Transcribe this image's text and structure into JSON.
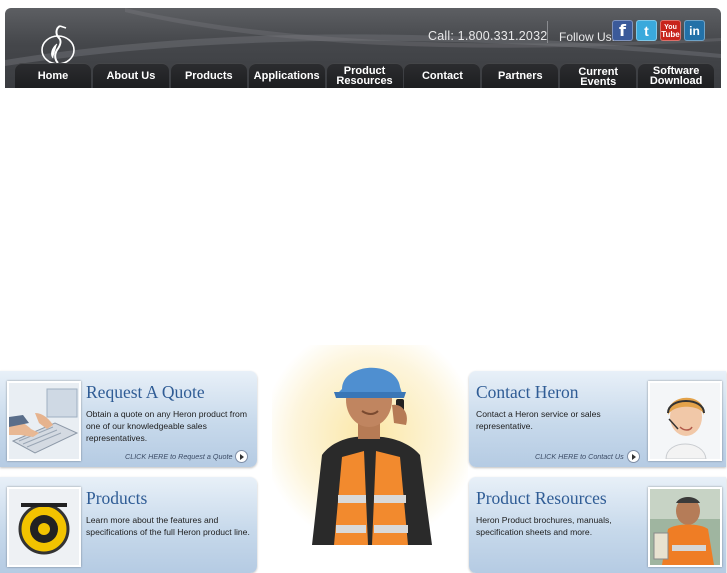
{
  "header": {
    "call_text": "Call: 1.800.331.2032",
    "follow_text": "Follow Us:",
    "social": [
      {
        "name": "facebook-icon",
        "glyph": "f"
      },
      {
        "name": "twitter-icon",
        "glyph": "t"
      },
      {
        "name": "youtube-icon",
        "glyph_top": "You",
        "glyph_bottom": "Tube"
      },
      {
        "name": "linkedin-icon",
        "glyph": "in"
      }
    ]
  },
  "nav": {
    "items": [
      {
        "line1": "Home",
        "line2": ""
      },
      {
        "line1": "About Us",
        "line2": ""
      },
      {
        "line1": "Products",
        "line2": ""
      },
      {
        "line1": "Applications",
        "line2": ""
      },
      {
        "line1": "Product",
        "line2": "Resources"
      },
      {
        "line1": "Contact",
        "line2": ""
      },
      {
        "line1": "Partners",
        "line2": ""
      },
      {
        "line1": "Current Events",
        "line2": ""
      },
      {
        "line1": "Software",
        "line2": "Download"
      }
    ]
  },
  "promos": {
    "quote": {
      "title": "Request A Quote",
      "text": "Obtain a quote on any Heron product from one of our knowledgeable sales representatives.",
      "cta": "CLICK HERE to Request a Quote"
    },
    "contact": {
      "title": "Contact Heron",
      "text": "Contact a Heron service or sales representative.",
      "cta": "CLICK HERE to Contact Us"
    },
    "products": {
      "title": "Products",
      "text": "Learn more about the features and specifications of the full Heron product line."
    },
    "resources": {
      "title": "Product Resources",
      "text": "Heron Product brochures, manuals, specification sheets and more."
    }
  },
  "colors": {
    "header_bg": "#45474b",
    "nav_tab": "#1d1e20",
    "promo_title": "#2f5c95",
    "promo_bg": "#c7d9eb"
  }
}
